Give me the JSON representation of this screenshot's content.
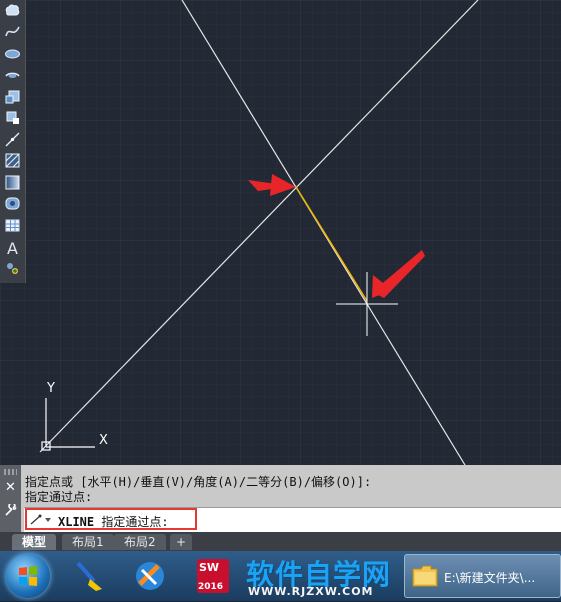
{
  "toolbar": {
    "tools": [
      {
        "name": "revision-cloud-icon"
      },
      {
        "name": "spline-icon"
      },
      {
        "name": "ellipse-icon"
      },
      {
        "name": "ellipse-arc-icon"
      },
      {
        "name": "insert-block-icon"
      },
      {
        "name": "make-block-icon"
      },
      {
        "name": "point-icon"
      },
      {
        "name": "hatch-icon"
      },
      {
        "name": "gradient-icon"
      },
      {
        "name": "region-icon"
      },
      {
        "name": "table-icon"
      },
      {
        "name": "multiline-text-icon",
        "label": "A"
      },
      {
        "name": "add-selected-icon"
      }
    ]
  },
  "drawing": {
    "ucs_x_label": "X",
    "ucs_y_label": "Y",
    "line_color": "#e6e6e6",
    "segment_color": "#f0b400",
    "arrow_color": "#e8262a"
  },
  "command_line": {
    "history_line1": "指定点或 [水平(H)/垂直(V)/角度(A)/二等分(B)/偏移(O)]:",
    "history_line2": "指定通过点:",
    "command_name": "XLINE",
    "prompt_text": "指定通过点:",
    "close_label": "✕"
  },
  "layout_tabs": {
    "tabs": [
      "模型",
      "布局1",
      "布局2"
    ],
    "add_label": "+"
  },
  "taskbar": {
    "solidworks_badge": "2016",
    "explorer_label": "E:\\新建文件夹\\..."
  },
  "watermark": {
    "main_text": "软件自学网",
    "url_text": "WWW.RJZXW.COM"
  }
}
